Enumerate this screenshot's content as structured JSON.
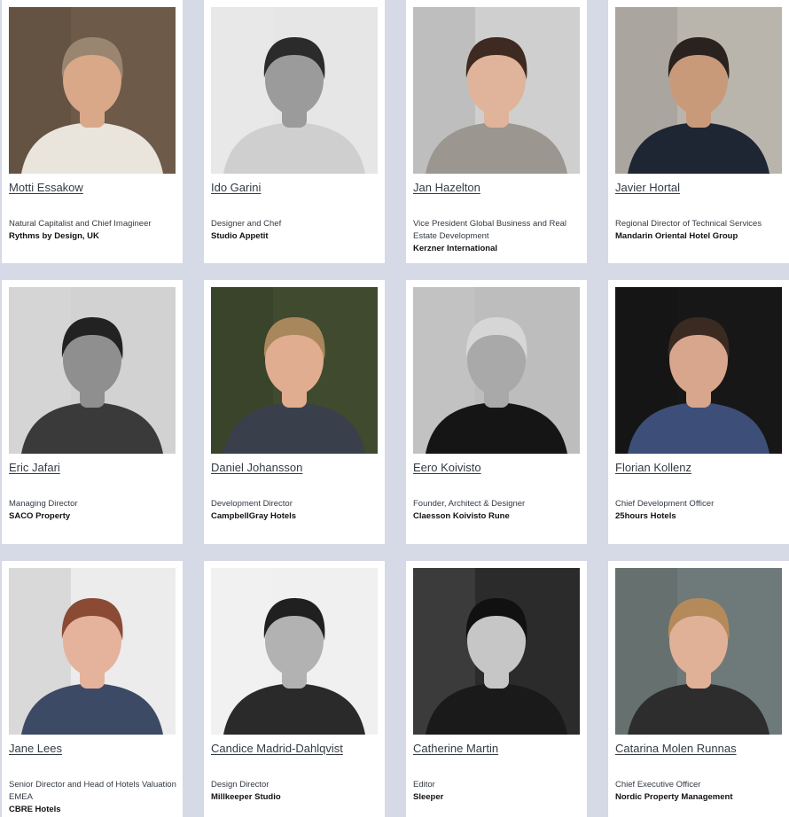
{
  "people": [
    {
      "name": "Motti Essakow",
      "role": "Natural Capitalist and Chief Imagineer",
      "company": "Rythms by Design, UK",
      "photo": {
        "bg": "#6d5a48",
        "skin": "#d8a889",
        "hair": "#9a8570",
        "cloth": "#e9e4dc",
        "grayscale": false
      }
    },
    {
      "name": "Ido Garini",
      "role": "Designer and Chef",
      "company": "Studio Appetit",
      "photo": {
        "bg": "#e6e6e6",
        "skin": "#9b9b9b",
        "hair": "#2b2b2b",
        "cloth": "#cfcfcf",
        "grayscale": true
      }
    },
    {
      "name": "Jan Hazelton",
      "role": "Vice President Global Business and Real Estate Development",
      "company": "Kerzner International",
      "photo": {
        "bg": "#cfcfcf",
        "skin": "#e0b49a",
        "hair": "#3e2a20",
        "cloth": "#9b9690",
        "grayscale": false
      }
    },
    {
      "name": "Javier Hortal",
      "role": "Regional Director of Technical Services",
      "company": "Mandarin Oriental Hotel Group",
      "photo": {
        "bg": "#b9b5ad",
        "skin": "#c99a7a",
        "hair": "#2a221e",
        "cloth": "#1f2633",
        "grayscale": false
      }
    },
    {
      "name": "Eric Jafari",
      "role": "Managing Director",
      "company": "SACO Property",
      "photo": {
        "bg": "#d2d2d2",
        "skin": "#8f8f8f",
        "hair": "#222222",
        "cloth": "#3a3a3a",
        "grayscale": true
      }
    },
    {
      "name": "Daniel Johansson",
      "role": "Development Director",
      "company": "CampbellGray Hotels",
      "photo": {
        "bg": "#3f4a2e",
        "skin": "#e1ad90",
        "hair": "#a9875c",
        "cloth": "#39404c",
        "grayscale": false
      }
    },
    {
      "name": "Eero Koivisto",
      "role": "Founder, Architect & Designer",
      "company": "Claesson Koivisto Rune",
      "photo": {
        "bg": "#bdbdbd",
        "skin": "#a9a9a9",
        "hair": "#d6d6d6",
        "cloth": "#151515",
        "grayscale": true
      }
    },
    {
      "name": "Florian Kollenz",
      "role": "Chief Development Officer",
      "company": "25hours Hotels",
      "photo": {
        "bg": "#171717",
        "skin": "#d7a68c",
        "hair": "#3a2a22",
        "cloth": "#3d4f78",
        "grayscale": false
      }
    },
    {
      "name": "Jane Lees",
      "role": "Senior Director and Head of Hotels Valuation EMEA",
      "company": "CBRE Hotels",
      "photo": {
        "bg": "#ececec",
        "skin": "#e5b39b",
        "hair": "#8a4a33",
        "cloth": "#3c4a66",
        "grayscale": false
      }
    },
    {
      "name": "Candice Madrid-Dahlqvist",
      "role": "Design Director",
      "company": "Millkeeper Studio",
      "photo": {
        "bg": "#f0f0f0",
        "skin": "#b2b2b2",
        "hair": "#202020",
        "cloth": "#2a2a2a",
        "grayscale": true
      }
    },
    {
      "name": "Catherine Martin",
      "role": "Editor",
      "company": "Sleeper",
      "photo": {
        "bg": "#2b2b2b",
        "skin": "#c6c6c6",
        "hair": "#111111",
        "cloth": "#1a1a1a",
        "grayscale": true
      }
    },
    {
      "name": "Catarina Molen Runnas",
      "role": "Chief Executive Officer",
      "company": "Nordic Property Management",
      "photo": {
        "bg": "#6e7a79",
        "skin": "#e0b197",
        "hair": "#b58a5a",
        "cloth": "#2d2d2d",
        "grayscale": false
      }
    }
  ]
}
